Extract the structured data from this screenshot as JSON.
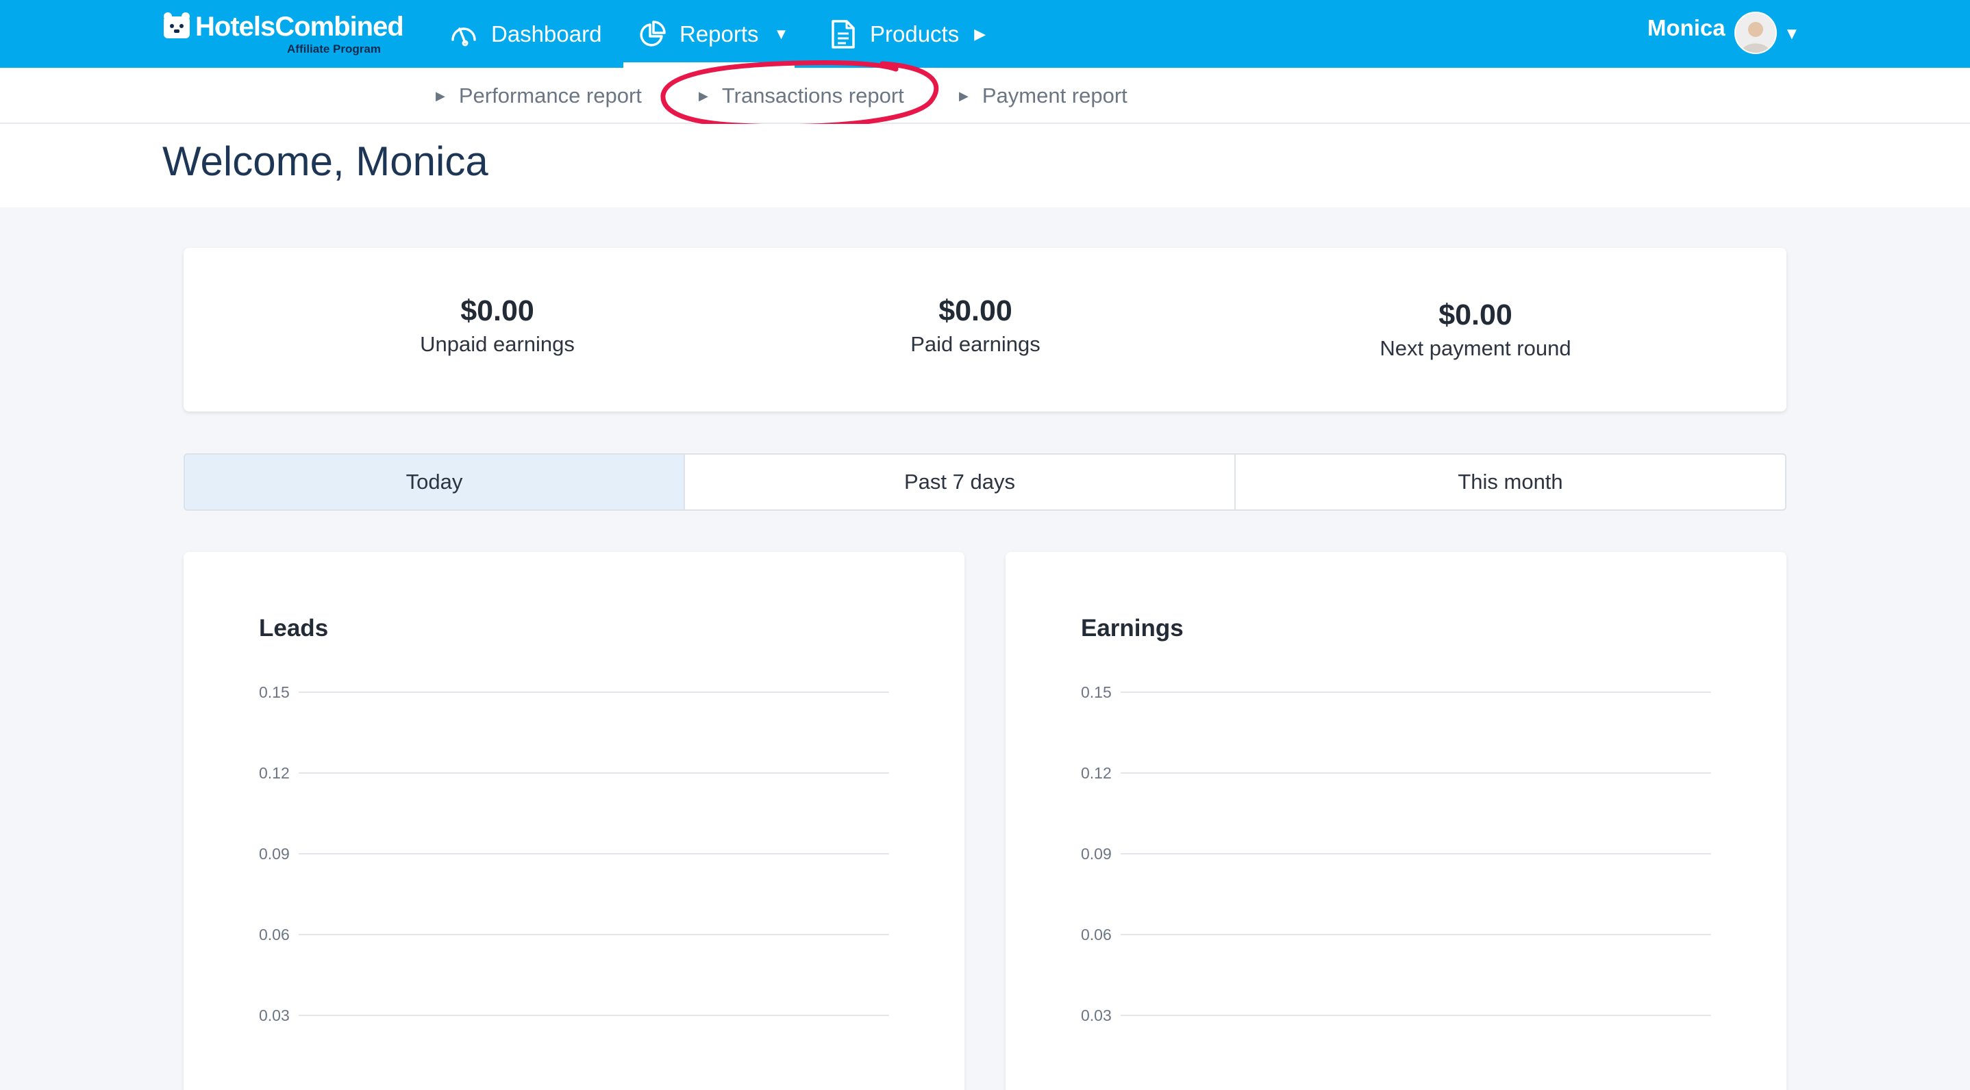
{
  "brand": {
    "name_part1": "Hotels",
    "name_part2": "Combined",
    "tagline": "Affiliate Program",
    "accent_color": "#03a9ed"
  },
  "topnav": {
    "items": [
      {
        "label": "Dashboard",
        "icon": "gauge-icon"
      },
      {
        "label": "Reports",
        "icon": "pie-chart-icon",
        "active": true,
        "caret": "▼"
      },
      {
        "label": "Products",
        "icon": "document-icon",
        "caret": "▶"
      }
    ],
    "user": {
      "name": "Monica",
      "caret": "▼"
    }
  },
  "subnav": {
    "items": [
      {
        "label": "Performance report"
      },
      {
        "label": "Transactions report",
        "highlighted": true
      },
      {
        "label": "Payment report"
      }
    ]
  },
  "welcome": "Welcome, Monica",
  "summary": [
    {
      "value": "$0.00",
      "label": "Unpaid earnings"
    },
    {
      "value": "$0.00",
      "label": "Paid earnings"
    },
    {
      "value": "$0.00",
      "label": "Next payment round"
    }
  ],
  "period_tabs": [
    {
      "label": "Today",
      "active": true
    },
    {
      "label": "Past 7 days"
    },
    {
      "label": "This month"
    }
  ],
  "chart_data": [
    {
      "type": "line",
      "title": "Leads",
      "xlabel": "",
      "ylabel": "",
      "y_ticks": [
        "0.15",
        "0.12",
        "0.09",
        "0.06",
        "0.03"
      ],
      "ylim": [
        0,
        0.15
      ],
      "grid": true,
      "series": []
    },
    {
      "type": "line",
      "title": "Earnings",
      "xlabel": "",
      "ylabel": "",
      "y_ticks": [
        "0.15",
        "0.12",
        "0.09",
        "0.06",
        "0.03"
      ],
      "ylim": [
        0,
        0.15
      ],
      "grid": true,
      "series": []
    }
  ]
}
